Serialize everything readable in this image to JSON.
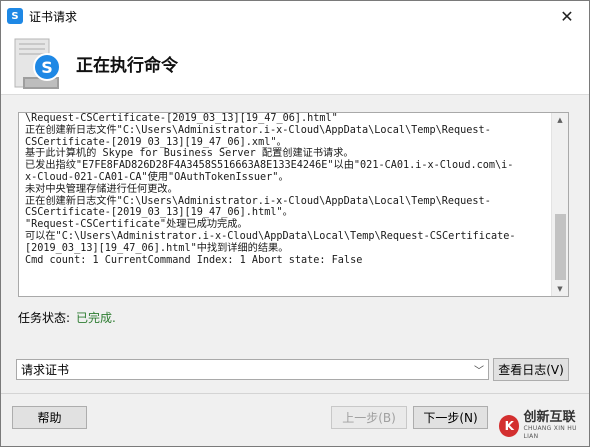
{
  "window": {
    "title": "证书请求",
    "app_icon_letter": "S",
    "close_glyph": "✕"
  },
  "header": {
    "title": "正在执行命令",
    "graphic_icon": "server-skype-icon"
  },
  "log": {
    "lines": [
      "\\Request-CSCertificate-[2019_03_13][19_47_06].html\"",
      "正在创建新日志文件\"C:\\Users\\Administrator.i-x-Cloud\\AppData\\Local\\Temp\\Request-",
      "CSCertificate-[2019_03_13][19_47_06].xml\"。",
      "基于此计算机的 Skype for Business Server 配置创建证书请求。",
      "已发出指纹\"E7FE8FAD826D28F4A3458S516663A8E133E4246E\"以由\"021-CA01.i-x-Cloud.com\\i-",
      "x-Cloud-021-CA01-CA\"使用\"OAuthTokenIssuer\"。",
      "未对中央管理存储进行任何更改。",
      "正在创建新日志文件\"C:\\Users\\Administrator.i-x-Cloud\\AppData\\Local\\Temp\\Request-",
      "CSCertificate-[2019_03_13][19_47_06].html\"。",
      "\"Request-CSCertificate\"处理已成功完成。",
      "可以在\"C:\\Users\\Administrator.i-x-Cloud\\AppData\\Local\\Temp\\Request-CSCertificate-",
      "[2019_03_13][19_47_06].html\"中找到详细的结果。",
      "Cmd count: 1 CurrentCommand Index: 1 Abort state: False"
    ],
    "scroll_position": 0.65
  },
  "status": {
    "label": "任务状态:",
    "value": "已完成.",
    "value_color": "#2e7d32"
  },
  "task_select": {
    "value": "请求证书",
    "arrow": "﹀"
  },
  "buttons": {
    "view_log": "查看日志(V)",
    "help": "帮助",
    "back": "上一步(B)",
    "next": "下一步(N)"
  },
  "watermark": {
    "logo_glyph": "K",
    "name": "创新互联",
    "sub": "CHUANG XIN HU LIAN"
  }
}
